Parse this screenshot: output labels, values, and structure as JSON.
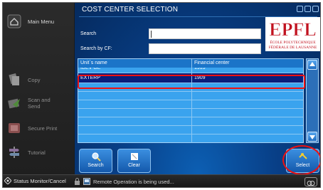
{
  "sidebar": {
    "main_menu": "Main Menu",
    "copy": "Copy",
    "scan_send": "Scan and\nSend",
    "secure_print": "Secure Print",
    "tutorial": "Tutorial"
  },
  "panel": {
    "title": "COST CENTER SELECTION",
    "search_label": "Search",
    "search_cf_label": "Search by CF:",
    "search_value": "",
    "search_cf_value": ""
  },
  "logo": {
    "mark": "EPFL",
    "line1": "ÉCOLE POLYTECHNIQUE",
    "line2": "FÉDÉRALE DE LAUSANNE"
  },
  "table": {
    "headers": [
      "Unit`s name",
      "Financial center"
    ],
    "rows": [
      {
        "unit": "IDEV-GE",
        "center": "1913"
      },
      {
        "unit": "EXTERP",
        "center": "1909"
      }
    ],
    "selected_index": 1,
    "empty_rows": 7
  },
  "buttons": {
    "search": "Search",
    "clear": "Clear",
    "select": "Select"
  },
  "statusbar": {
    "status_monitor": "Status Monitor/Cancel",
    "message": "Remote Operation is being used..."
  },
  "colors": {
    "panel_blue": "#083f87",
    "grid_blue": "#3aa3ee",
    "selected_row": "#0a1e7a",
    "highlight_red": "#ee1111",
    "epfl_red": "#c1121f"
  }
}
